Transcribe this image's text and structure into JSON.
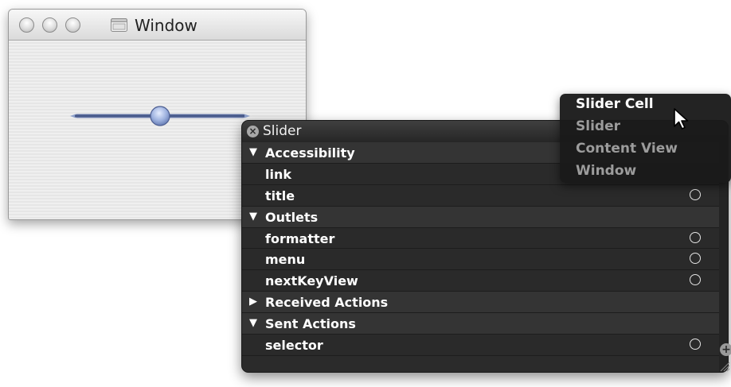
{
  "window": {
    "title": "Window",
    "slider_value": 0.5,
    "buttons": [
      "close",
      "minimize",
      "zoom"
    ]
  },
  "inspector": {
    "title": "Slider",
    "rows": [
      {
        "type": "section",
        "label": "Accessibility",
        "expanded": true
      },
      {
        "type": "item",
        "label": "link",
        "connector": false
      },
      {
        "type": "item",
        "label": "title",
        "connector": true
      },
      {
        "type": "section",
        "label": "Outlets",
        "expanded": true
      },
      {
        "type": "item",
        "label": "formatter",
        "connector": true
      },
      {
        "type": "item",
        "label": "menu",
        "connector": true
      },
      {
        "type": "item",
        "label": "nextKeyView",
        "connector": true
      },
      {
        "type": "section",
        "label": "Received Actions",
        "expanded": false
      },
      {
        "type": "section",
        "label": "Sent Actions",
        "expanded": true
      },
      {
        "type": "item",
        "label": "selector",
        "connector": true
      }
    ],
    "expanded_glyph": "▼",
    "collapsed_glyph": "▶"
  },
  "popup_menu": {
    "items": [
      {
        "label": "Slider Cell",
        "selected": true
      },
      {
        "label": "Slider",
        "selected": false
      },
      {
        "label": "Content View",
        "selected": false
      },
      {
        "label": "Window",
        "selected": false
      }
    ]
  },
  "icons": {
    "close": "close-icon",
    "proxy": "window-proxy-icon",
    "cursor": "arrow-cursor-icon"
  }
}
